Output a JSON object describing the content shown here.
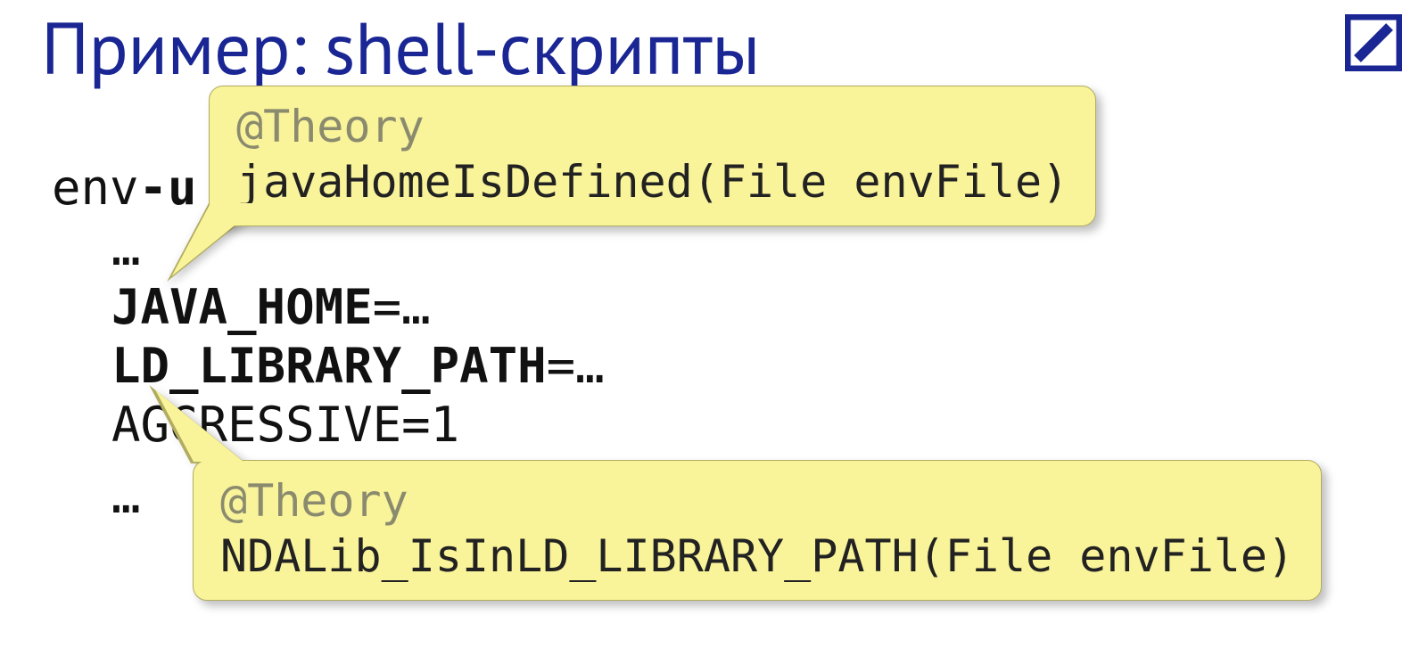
{
  "title": "Пример: shell-скрипты",
  "logo": {
    "name": "deutsche-bank-slash-logo"
  },
  "code": {
    "env_prefix": "env",
    "env_suffix_bold": "-u",
    "dots": "…",
    "java_home": "JAVA_HOME",
    "ld_path": "LD_LIBRARY_PATH",
    "eq_ell": "=…",
    "aggressive": "AGGRESSIVE=1"
  },
  "callout_top": {
    "annotation": "@Theory",
    "text": "javaHomeIsDefined(File envFile)"
  },
  "callout_bot": {
    "annotation": "@Theory",
    "text": "NDALib_IsInLD_LIBRARY_PATH(File envFile)"
  }
}
